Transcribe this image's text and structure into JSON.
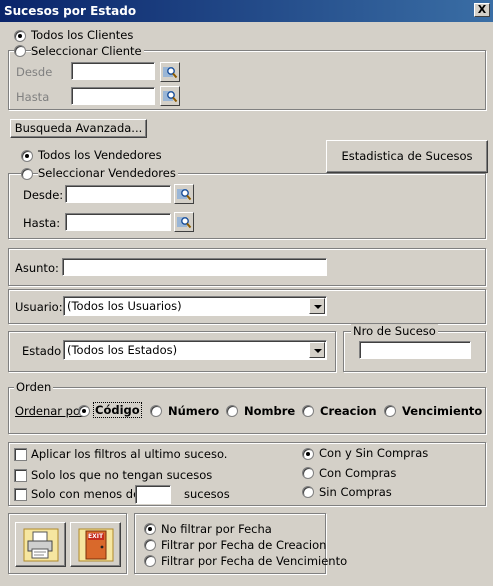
{
  "window": {
    "title": "Sucesos por Estado",
    "close": "X"
  },
  "clientes": {
    "todos": "Todos los Clientes",
    "seleccionar": "Seleccionar Cliente",
    "desde": "Desde",
    "hasta": "Hasta"
  },
  "busqueda_btn": "Busqueda Avanzada...",
  "vendedores": {
    "todos": "Todos los Vendedores",
    "seleccionar": "Seleccionar Vendedores",
    "desde": "Desde:",
    "hasta": "Hasta:"
  },
  "estadistica_btn": "Estadistica de Sucesos",
  "asunto": {
    "label": "Asunto:",
    "value": ""
  },
  "usuario": {
    "label": "Usuario:",
    "value": "(Todos los Usuarios)"
  },
  "estado": {
    "label": "Estado",
    "value": "(Todos los Estados)"
  },
  "nro_suceso": {
    "label": "Nro de Suceso",
    "value": ""
  },
  "orden": {
    "legend": "Orden",
    "label": "Ordenar por",
    "options": [
      "Código",
      "Número",
      "Nombre",
      "Creacion",
      "Vencimiento"
    ],
    "selected": "Código"
  },
  "filtros": {
    "aplicar": "Aplicar los filtros al ultimo suceso.",
    "sin_sucesos": "Solo los que no tengan sucesos",
    "menos_de": "Solo con menos de",
    "sucesos": "sucesos",
    "menos_de_value": ""
  },
  "compras": {
    "options": [
      "Con y Sin Compras",
      "Con Compras",
      "Sin Compras"
    ],
    "selected": "Con y Sin Compras"
  },
  "fechas": {
    "options": [
      "No filtrar por Fecha",
      "Filtrar por Fecha de Creacion",
      "Filtrar por Fecha de Vencimiento"
    ],
    "selected": "No filtrar por Fecha"
  },
  "actions": {
    "print_icon": "printer-icon",
    "exit_icon": "exit-door-icon",
    "exit_text": "EXIT"
  }
}
